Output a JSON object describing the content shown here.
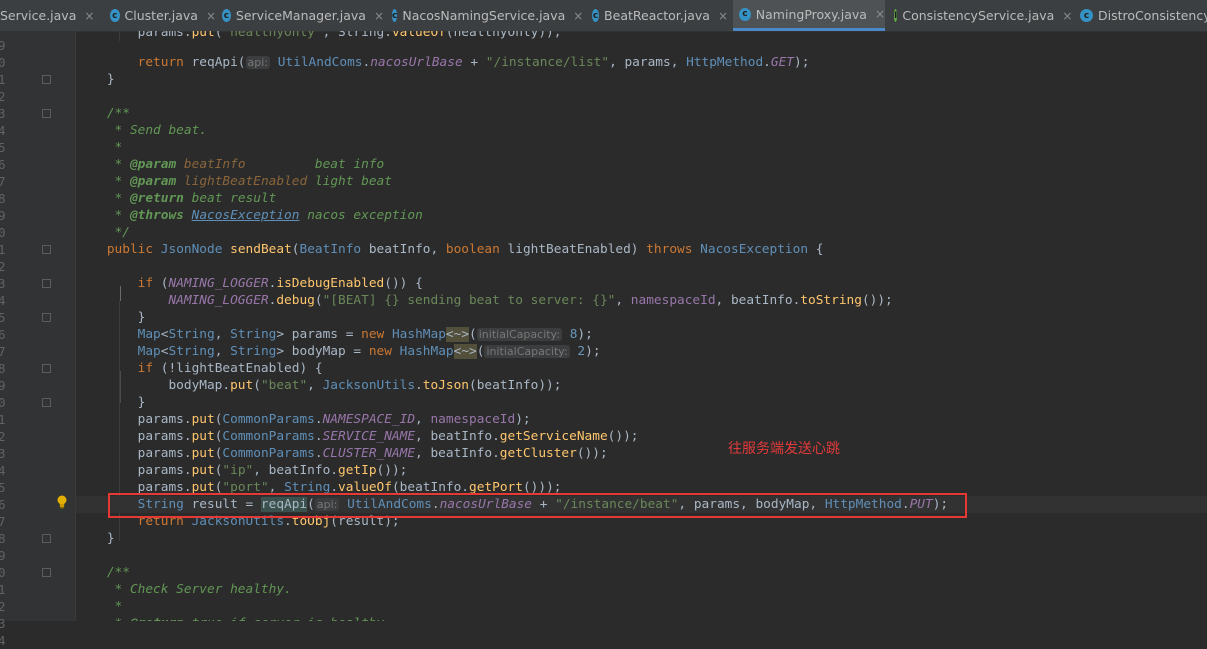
{
  "tabs": [
    {
      "label": "Service.java",
      "icon": "c"
    },
    {
      "label": "Cluster.java",
      "icon": "c"
    },
    {
      "label": "ServiceManager.java",
      "icon": "c"
    },
    {
      "label": "NacosNamingService.java",
      "icon": "c"
    },
    {
      "label": "BeatReactor.java",
      "icon": "c"
    },
    {
      "label": "NamingProxy.java",
      "icon": "c",
      "active": true
    },
    {
      "label": "ConsistencyService.java",
      "icon": "i"
    },
    {
      "label": "DistroConsistencyS",
      "icon": "c"
    }
  ],
  "tab_close_glyph": "×",
  "line_numbers": [
    "9",
    "0",
    "1",
    "2",
    "3",
    "4",
    "5",
    "6",
    "7",
    "8",
    "9",
    "0",
    "1",
    "2",
    "3",
    "4",
    "5",
    "6",
    "7",
    "8",
    "9",
    "0",
    "1",
    "2",
    "3",
    "4",
    "5",
    "6",
    "7",
    "8",
    "9",
    "0",
    "1",
    "2",
    "3",
    "4",
    "5"
  ],
  "annotation": "往服务端发送心跳",
  "colors": {
    "highlight_box": "#e53935",
    "annotation": "#e03a3a",
    "active_tab_underline": "#4a88c7"
  }
}
